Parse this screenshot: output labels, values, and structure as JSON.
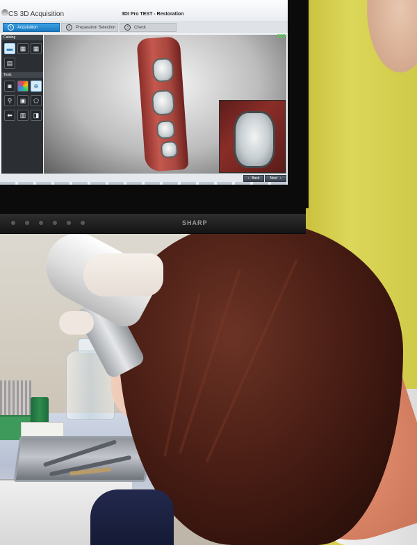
{
  "app": {
    "title": "CS 3D Acquisition",
    "window_title": "3DI Pro TEST - Restoration"
  },
  "workflow_steps": [
    {
      "number": "1",
      "label": "Acquisition",
      "active": true
    },
    {
      "number": "2",
      "label": "Preparation Selection",
      "active": false
    },
    {
      "number": "3",
      "label": "Check",
      "active": false
    }
  ],
  "sidebar": {
    "catalog_label": "Catalog",
    "tools_label": "Tools"
  },
  "viewport": {
    "counter": "223"
  },
  "navigation": {
    "back_label": "Back",
    "next_label": "Next"
  },
  "monitor": {
    "brand": "SHARP"
  },
  "colors": {
    "active_step": "#1e88d6",
    "counter": "#3fe03f",
    "tissue": "#b5463e"
  }
}
